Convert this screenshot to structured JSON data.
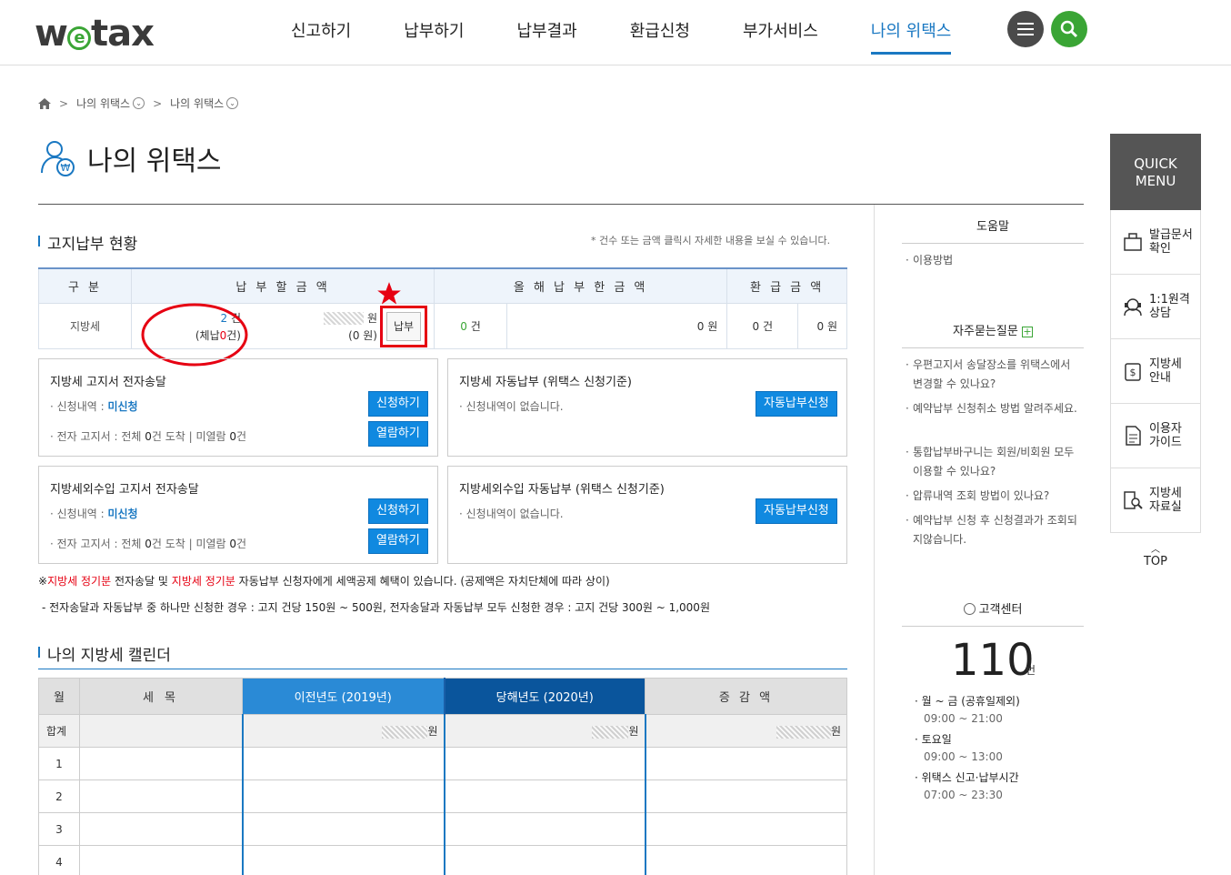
{
  "header": {
    "logo": "wetax",
    "nav": [
      "신고하기",
      "납부하기",
      "납부결과",
      "환급신청",
      "부가서비스",
      "나의 위택스"
    ]
  },
  "breadcrumb": [
    "나의 위택스",
    "나의 위택스"
  ],
  "page_title": "나의 위택스",
  "billing": {
    "title": "고지납부 현황",
    "note": "* 건수 또는 금액 클릭시 자세한 내용을 보실 수 있습니다.",
    "headers": [
      "구 분",
      "납 부 할  금 액",
      "올 해  납 부 한  금 액",
      "환 급 금 액"
    ],
    "row": {
      "label": "지방세",
      "due_count": "2",
      "count_unit": "건",
      "arrears_prefix": "(체납",
      "arrears_count": "0",
      "arrears_suffix": "건)",
      "due_amount_unit": "원",
      "due_arrears_amount": "(0 원)",
      "pay_button": "납부",
      "paid_count": "0",
      "paid_amount": "0 원",
      "refund_count": "0 건",
      "refund_amount": "0 원"
    }
  },
  "boxes": {
    "local_tax_esend": {
      "title": "지방세 고지서 전자송달",
      "apply_label": "· 신청내역 : ",
      "apply_status": "미신청",
      "apply_button": "신청하기",
      "bill_prefix": "· 전자 고지서 : 전체 ",
      "bill_total": "0",
      "bill_mid": "건 도착   |   미열람 ",
      "bill_unread": "0",
      "bill_suffix": "건",
      "view_button": "열람하기"
    },
    "local_tax_autopay": {
      "title": "지방세 자동납부 (위택스 신청기준)",
      "status": "· 신청내역이 없습니다.",
      "button": "자동납부신청"
    },
    "nontax_esend": {
      "title": "지방세외수입 고지서 전자송달",
      "apply_label": "· 신청내역 : ",
      "apply_status": "미신청",
      "apply_button": "신청하기",
      "bill_prefix": "· 전자 고지서 : 전체 ",
      "bill_total": "0",
      "bill_mid": "건 도착   |   미열람 ",
      "bill_unread": "0",
      "bill_suffix": "건",
      "view_button": "열람하기"
    },
    "nontax_autopay": {
      "title": "지방세외수입 자동납부 (위택스 신청기준)",
      "status": "· 신청내역이 없습니다.",
      "button": "자동납부신청"
    }
  },
  "notice": {
    "mark": "※",
    "red1": "지방세 정기분",
    "text1": " 전자송달 및 ",
    "red2": "지방세 정기분",
    "text2": " 자동납부 신청자에게 세액공제 혜택이 있습니다. (공제액은 자치단체에 따라 상이)",
    "line2": "- 전자송달과 자동납부 중 하나만 신청한 경우 : 고지 건당 150원 ~ 500원, 전자송달과 자동납부 모두 신청한 경우 : 고지 건당 300원 ~ 1,000원"
  },
  "calendar": {
    "title": "나의 지방세 캘린더",
    "headers": [
      "월",
      "세   목",
      "이전년도 (2019년)",
      "당해년도 (2020년)",
      "증 감 액"
    ],
    "sum_label": "합계",
    "sum_values": [
      "원",
      "원",
      "원"
    ],
    "months": [
      "1",
      "2",
      "3",
      "4"
    ]
  },
  "help": {
    "title": "도움말",
    "usage": "이용방법",
    "faq_title": "자주묻는질문",
    "faq": [
      "우편고지서 송달장소를 위택스에서 변경할 수 있나요?",
      "예약납부 신청취소 방법 알려주세요.",
      "통합납부바구니는 회원/비회원 모두 이용할 수 있나요?",
      "압류내역 조회 방법이 있나요?",
      "예약납부 신청 후 신청결과가 조회되지않습니다."
    ],
    "cs_title": "고객센터",
    "cs_number": "110",
    "cs_unit": "번",
    "cs_hours": [
      {
        "label": "· 월 ~ 금 (공휴일제외)",
        "time": "09:00 ~ 21:00"
      },
      {
        "label": "· 토요일",
        "time": "09:00 ~ 13:00"
      },
      {
        "label": "· 위택스 신고·납부시간",
        "time": "07:00 ~ 23:30"
      }
    ]
  },
  "quick_menu": {
    "title_line1": "QUICK",
    "title_line2": "MENU",
    "items": [
      {
        "l1": "발급문서",
        "l2": "확인"
      },
      {
        "l1": "1:1원격",
        "l2": "상담"
      },
      {
        "l1": "지방세",
        "l2": "안내"
      },
      {
        "l1": "이용자",
        "l2": "가이드"
      },
      {
        "l1": "지방세",
        "l2": "자료실"
      }
    ],
    "top": "TOP"
  }
}
